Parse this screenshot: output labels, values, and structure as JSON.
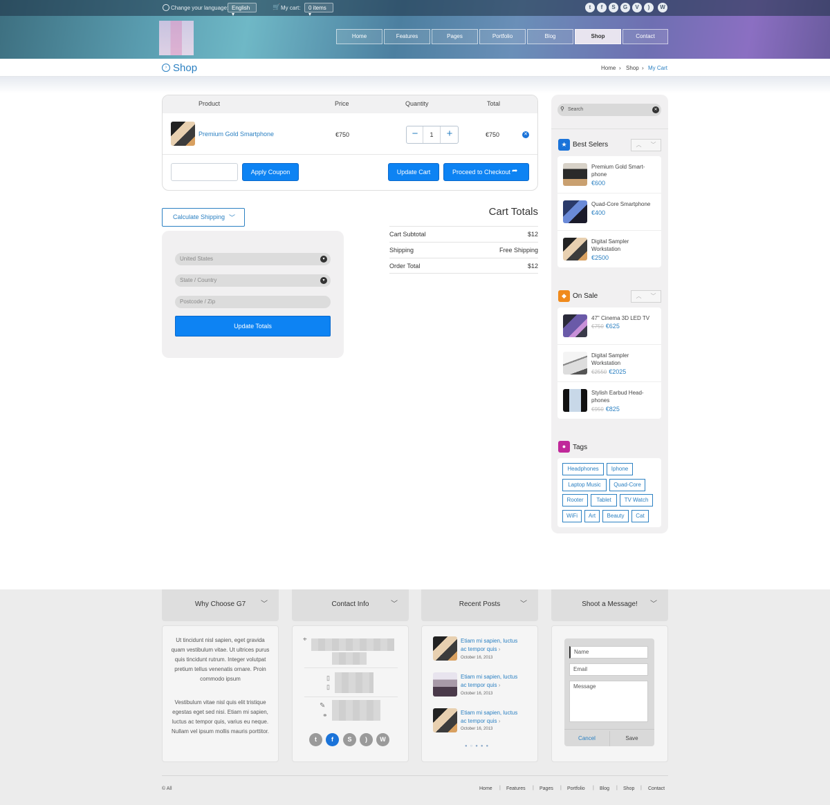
{
  "topbar": {
    "language_label": "Change your language:",
    "language_value": "English",
    "cart_label": "My cart:",
    "cart_value": "0 items",
    "social_icons": [
      "twitter-icon",
      "facebook-icon",
      "skype-icon",
      "google-plus-icon",
      "vimeo-icon",
      "rss-icon",
      "wordpress-icon"
    ]
  },
  "nav": {
    "items": [
      "Home",
      "Features",
      "Pages",
      "Portfolio",
      "Blog",
      "Shop",
      "Contact"
    ],
    "active": "Shop"
  },
  "titlebar": {
    "title": "Shop",
    "breadcrumb": [
      "Home",
      "Shop",
      "My Cart"
    ]
  },
  "cart": {
    "headers": [
      "Product",
      "Price",
      "Quantity",
      "Total"
    ],
    "item": {
      "name": "Premium Gold Smartphone",
      "price": "€750",
      "quantity": "1",
      "total": "€750"
    },
    "apply_coupon": "Apply Coupon",
    "update_cart": "Update Cart",
    "checkout": "Proceed to Checkout"
  },
  "shipping": {
    "toggle_label": "Calculate Shipping",
    "country": "United States",
    "state_placeholder": "State / Country",
    "postcode_placeholder": "Postcode / Zip",
    "update_totals": "Update Totals"
  },
  "totals": {
    "title": "Cart Totals",
    "rows": [
      {
        "label": "Cart Subtotal",
        "value": "$12"
      },
      {
        "label": "Shipping",
        "value": "Free Shipping"
      },
      {
        "label": "Order Total",
        "value": "$12"
      }
    ]
  },
  "sidebar": {
    "search_placeholder": "Search",
    "best_sellers": {
      "title": "Best Selers",
      "items": [
        {
          "name": "Premium Gold Smart- phone",
          "price": "€600"
        },
        {
          "name": "Quad-Core Smartphone",
          "price": "€400"
        },
        {
          "name": "Digital Sampler Workstation",
          "price": "€2500"
        }
      ]
    },
    "on_sale": {
      "title": "On Sale",
      "items": [
        {
          "name": "47\" Cinema 3D LED TV",
          "old_price": "€750",
          "price": "€625"
        },
        {
          "name": "Digital Sampler Workstation",
          "old_price": "€2550",
          "price": "€2025"
        },
        {
          "name": "Stylish Earbud Head- phones",
          "old_price": "€950",
          "price": "€825"
        }
      ]
    },
    "tags": {
      "title": "Tags",
      "items": [
        "Headphones",
        "Iphone",
        "Laptop Music",
        "Quad-Core",
        "Rooter",
        "Tablet",
        "TV Watch",
        "WiFi",
        "Art",
        "Beauty",
        "Cat"
      ]
    }
  },
  "footer": {
    "tabs": [
      "Why Choose G7",
      "Contact Info",
      "Recent Posts",
      "Shoot a Message!"
    ],
    "why_text_1": "Ut tincidunt nisl sapien, eget gravida quam vestibulum vitae. Ut ultrices purus quis tincidunt rutrum. Integer volutpat pretium tellus venenatis ornare. Proin commodo ipsum",
    "why_text_2": "Vestibulum vitae nisl quis elit tristique egestas eget sed nisi. Etiam mi sapien, luctus ac tempor quis, varius eu neque. Nullam vel ipsum mollis mauris porttitor.",
    "contact_social_icons": [
      "twitter-icon",
      "facebook-icon",
      "skype-icon",
      "rss-icon",
      "wordpress-icon"
    ],
    "posts": [
      {
        "title": "Etiam mi sapien, luctus ac tempor quis",
        "date": "October 16, 2013"
      },
      {
        "title": "Etiam mi sapien, luctus ac tempor quis",
        "date": "October 16, 2013"
      },
      {
        "title": "Etiam mi sapien, luctus ac tempor quis",
        "date": "October 16, 2013"
      }
    ],
    "message_form": {
      "name_placeholder": "Name",
      "email_placeholder": "Email",
      "message_placeholder": "Message",
      "cancel": "Cancel",
      "save": "Save"
    },
    "copyright": "© All",
    "nav": [
      "Home",
      "Features",
      "Pages",
      "Portfolio",
      "Blog",
      "Shop",
      "Contact"
    ]
  },
  "colors": {
    "accent": "#0d83f3",
    "link": "#2b80c2",
    "best_sellers_icon": "#1a73d9",
    "on_sale_icon": "#f08a1c",
    "tags_icon": "#c0289a"
  }
}
